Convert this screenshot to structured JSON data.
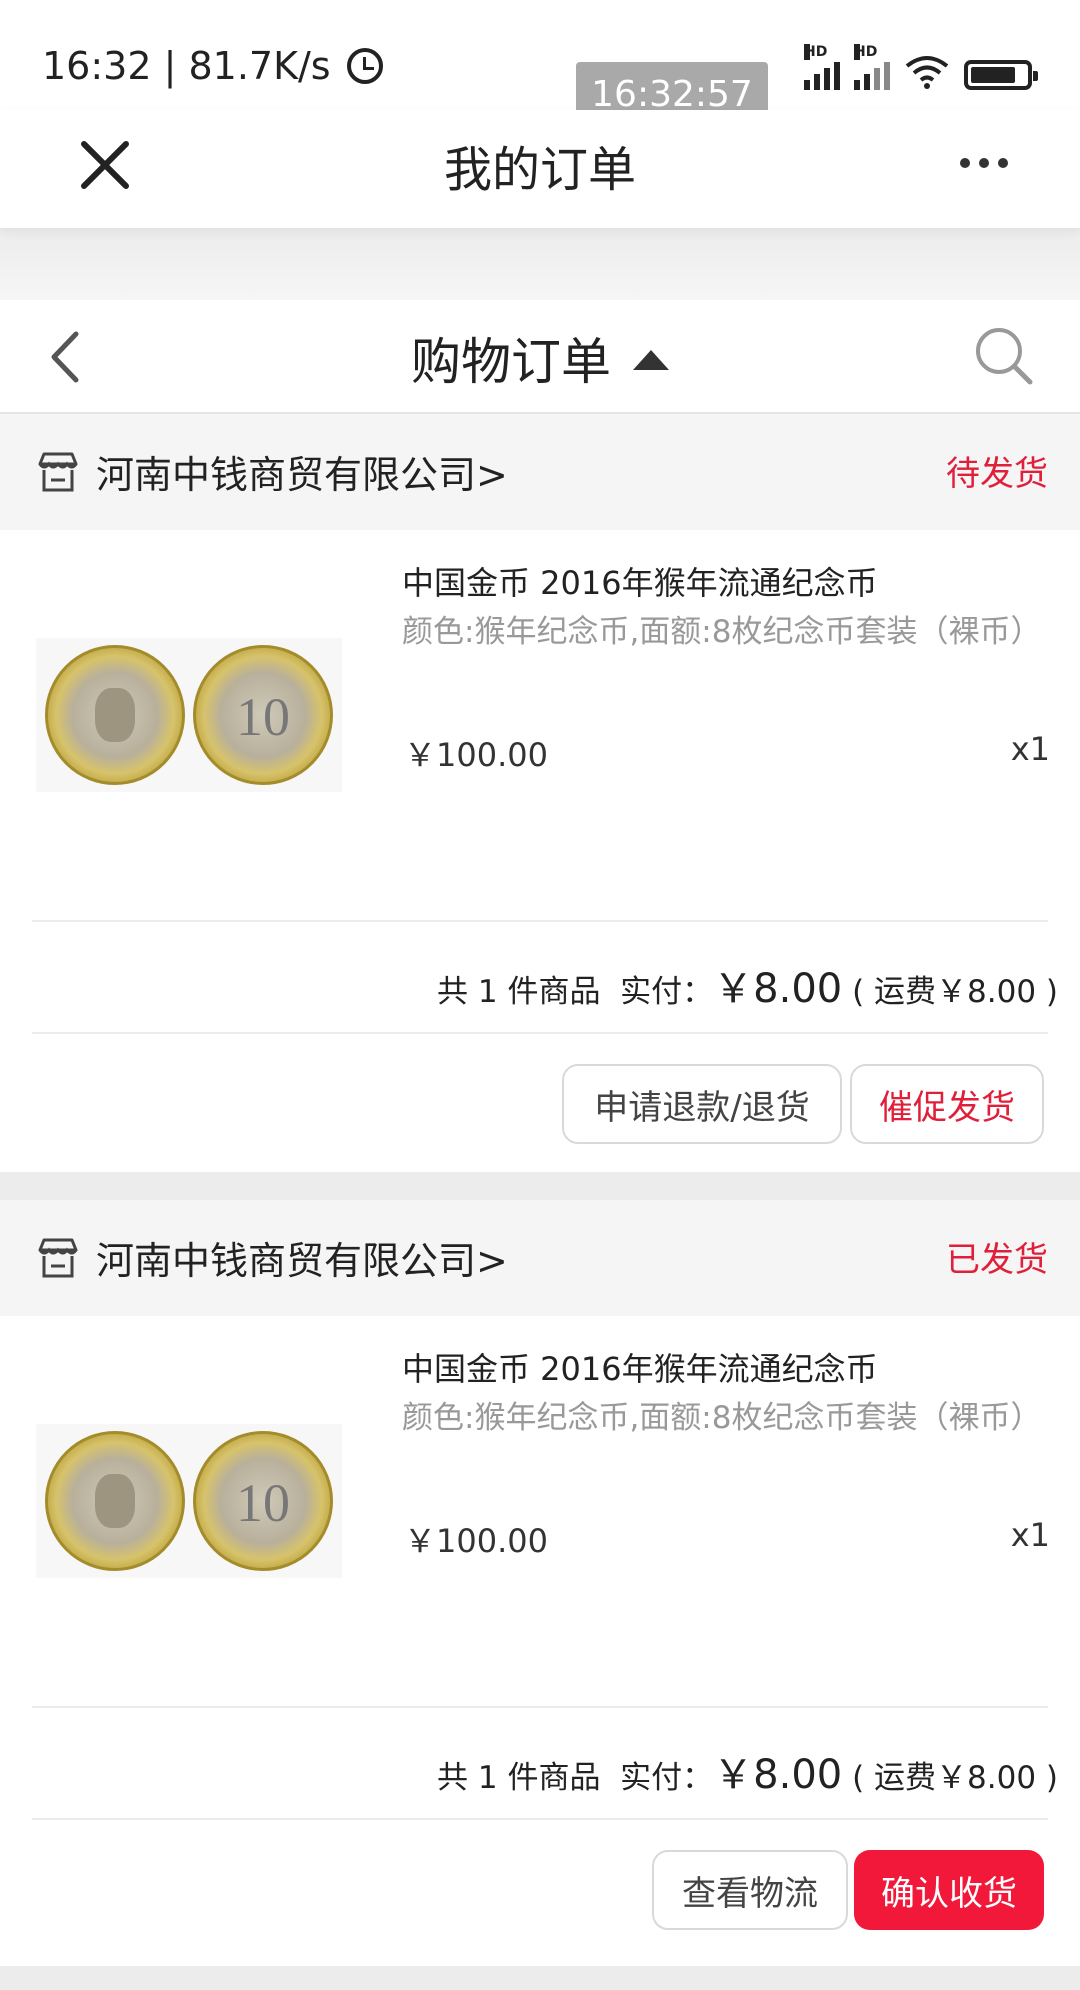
{
  "status_bar": {
    "time_speed": "16:32 | 81.7K/s",
    "overlay_time": "16:32:57",
    "signal_label": "HD"
  },
  "titlebar": {
    "title": "我的订单"
  },
  "subheader": {
    "title": "购物订单"
  },
  "orders": [
    {
      "store": "河南中钱商贸有限公司>",
      "status": "待发货",
      "item_name": "中国金币 2016年猴年流通纪念币",
      "item_spec": "颜色:猴年纪念币,面额:8枚纪念币套装（裸币）",
      "price": "￥100.00",
      "qty": "x1",
      "coin_text": "10",
      "total_prefix": "共 1 件商品  实付：",
      "total_amount": "￥8.00",
      "total_suffix": " ( 运费￥8.00 )",
      "buttons": [
        "申请退款/退货",
        "催促发货"
      ]
    },
    {
      "store": "河南中钱商贸有限公司>",
      "status": "已发货",
      "item_name": "中国金币 2016年猴年流通纪念币",
      "item_spec": "颜色:猴年纪念币,面额:8枚纪念币套装（裸币）",
      "price": "￥100.00",
      "qty": "x1",
      "coin_text": "10",
      "total_prefix": "共 1 件商品  实付：",
      "total_amount": "￥8.00",
      "total_suffix": " ( 运费￥8.00 )",
      "buttons": [
        "查看物流",
        "确认收货"
      ]
    }
  ],
  "colors": {
    "accent_red": "#e0203a",
    "button_red": "#f2183a"
  },
  "icons": [
    "close-icon",
    "more-icon",
    "back-icon",
    "caret-up-icon",
    "search-icon",
    "store-icon",
    "coin-image"
  ]
}
